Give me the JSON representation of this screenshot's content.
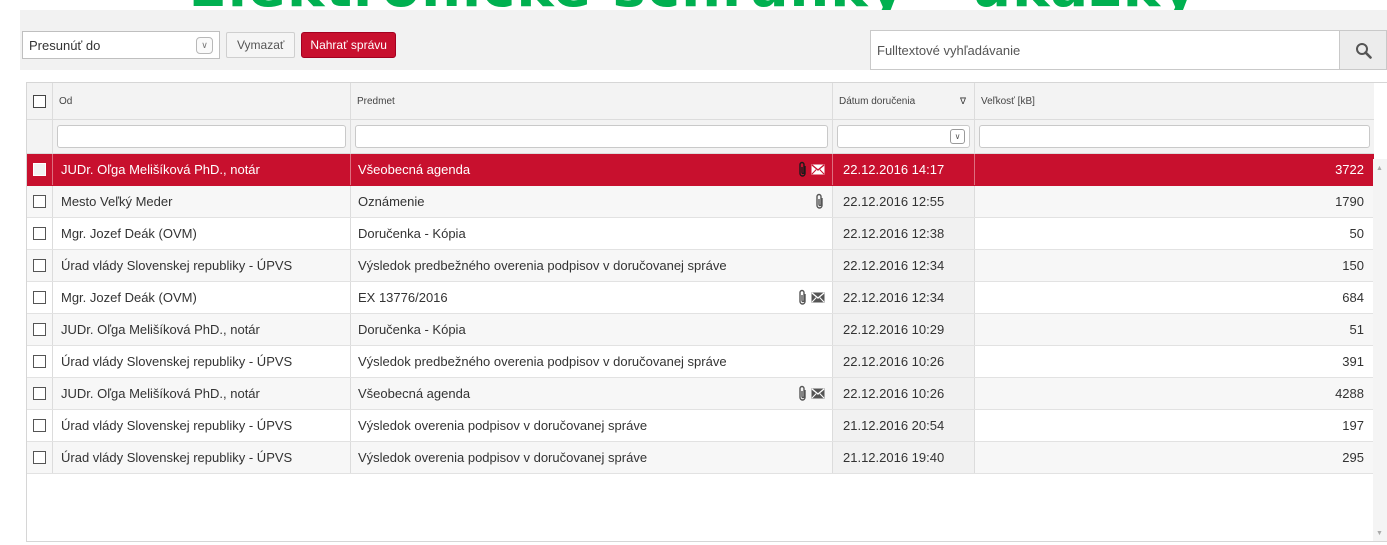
{
  "banner": {
    "text": "Elektronické schránky - ukážky"
  },
  "toolbar": {
    "move_select_value": "Presunúť do",
    "clear_label": "Vymazať",
    "upload_label": "Nahrať správu"
  },
  "search": {
    "placeholder": "Fulltextové vyhľadávanie"
  },
  "colors": {
    "accent": "#c8102e",
    "banner": "#00b050"
  },
  "table": {
    "columns": {
      "from": "Od",
      "subject": "Predmet",
      "delivered": "Dátum doručenia",
      "size": "Veľkosť [kB]"
    },
    "sort_indicator": "∇",
    "rows": [
      {
        "from": "JUDr. Oľga Melišíková PhD., notár",
        "subject": "Všeobecná agenda",
        "date": "22.12.2016 14:17",
        "size": "3722",
        "icons": [
          "paperclip-icon",
          "envelope-icon"
        ],
        "selected": true
      },
      {
        "from": "Mesto Veľký Meder",
        "subject": "Oznámenie",
        "date": "22.12.2016 12:55",
        "size": "1790",
        "icons": [
          "paperclip-icon"
        ],
        "selected": false
      },
      {
        "from": "Mgr. Jozef Deák (OVM)",
        "subject": "Doručenka - Kópia",
        "date": "22.12.2016 12:38",
        "size": "50",
        "icons": [],
        "selected": false
      },
      {
        "from": "Úrad vlády Slovenskej republiky - ÚPVS",
        "subject": "Výsledok predbežného overenia podpisov v doručovanej správe",
        "date": "22.12.2016 12:34",
        "size": "150",
        "icons": [],
        "selected": false
      },
      {
        "from": "Mgr. Jozef Deák (OVM)",
        "subject": "EX 13776/2016",
        "date": "22.12.2016 12:34",
        "size": "684",
        "icons": [
          "paperclip-icon",
          "envelope-icon"
        ],
        "selected": false
      },
      {
        "from": "JUDr. Oľga Melišíková PhD., notár",
        "subject": "Doručenka - Kópia",
        "date": "22.12.2016 10:29",
        "size": "51",
        "icons": [],
        "selected": false
      },
      {
        "from": "Úrad vlády Slovenskej republiky - ÚPVS",
        "subject": "Výsledok predbežného overenia podpisov v doručovanej správe",
        "date": "22.12.2016 10:26",
        "size": "391",
        "icons": [],
        "selected": false
      },
      {
        "from": "JUDr. Oľga Melišíková PhD., notár",
        "subject": "Všeobecná agenda",
        "date": "22.12.2016 10:26",
        "size": "4288",
        "icons": [
          "paperclip-icon",
          "envelope-icon"
        ],
        "selected": false
      },
      {
        "from": "Úrad vlády Slovenskej republiky - ÚPVS",
        "subject": "Výsledok overenia podpisov v doručovanej správe",
        "date": "21.12.2016 20:54",
        "size": "197",
        "icons": [],
        "selected": false
      },
      {
        "from": "Úrad vlády Slovenskej republiky - ÚPVS",
        "subject": "Výsledok overenia podpisov v doručovanej správe",
        "date": "21.12.2016 19:40",
        "size": "295",
        "icons": [],
        "selected": false
      }
    ]
  }
}
